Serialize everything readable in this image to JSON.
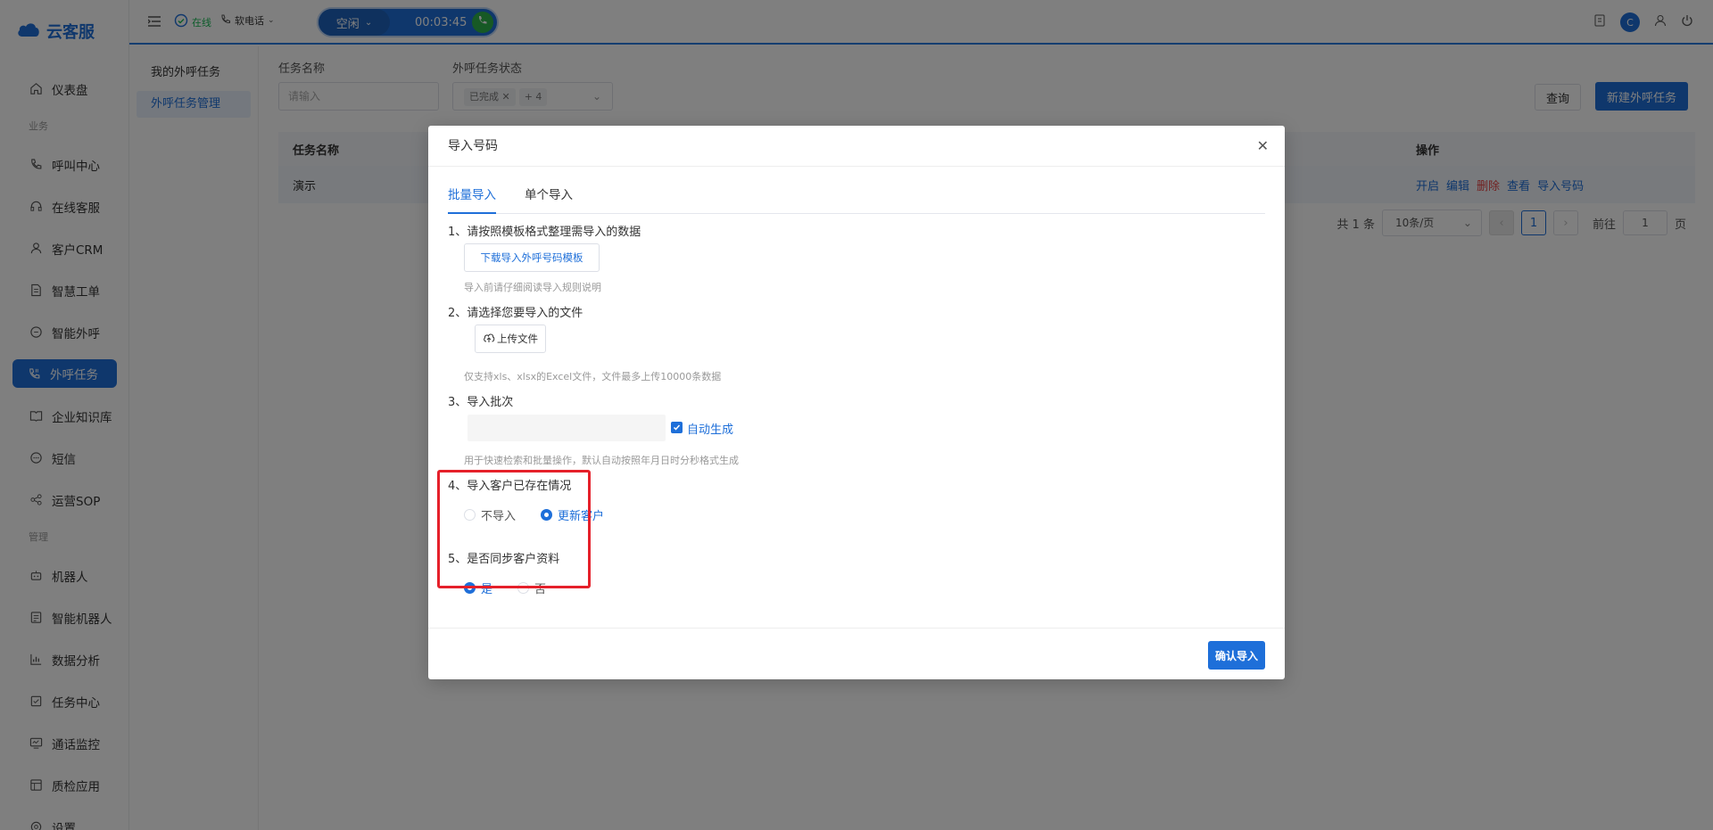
{
  "app": {
    "logo_text": "云客服"
  },
  "sidebar": {
    "items": [
      {
        "type": "item",
        "label": "仪表盘",
        "icon": "home-icon"
      },
      {
        "type": "group",
        "label": "业务"
      },
      {
        "type": "item",
        "label": "呼叫中心",
        "icon": "phone-icon"
      },
      {
        "type": "item",
        "label": "在线客服",
        "icon": "headset-icon"
      },
      {
        "type": "item",
        "label": "客户CRM",
        "icon": "user-icon"
      },
      {
        "type": "item",
        "label": "智慧工单",
        "icon": "document-icon"
      },
      {
        "type": "item",
        "label": "智能外呼",
        "icon": "outbound-call-icon"
      },
      {
        "type": "item",
        "label": "外呼任务",
        "icon": "phone-task-icon",
        "active": true
      },
      {
        "type": "item",
        "label": "企业知识库",
        "icon": "book-icon"
      },
      {
        "type": "item",
        "label": "短信",
        "icon": "message-icon"
      },
      {
        "type": "item",
        "label": "运营SOP",
        "icon": "share-icon"
      },
      {
        "type": "group",
        "label": "管理"
      },
      {
        "type": "item",
        "label": "机器人",
        "icon": "robot-icon"
      },
      {
        "type": "item",
        "label": "智能机器人",
        "icon": "smart-robot-icon"
      },
      {
        "type": "item",
        "label": "数据分析",
        "icon": "chart-icon"
      },
      {
        "type": "item",
        "label": "任务中心",
        "icon": "task-icon"
      },
      {
        "type": "item",
        "label": "通话监控",
        "icon": "monitor-icon"
      },
      {
        "type": "item",
        "label": "质检应用",
        "icon": "quality-icon"
      },
      {
        "type": "item",
        "label": "设置",
        "icon": "settings-icon"
      }
    ]
  },
  "topbar": {
    "online_label": "在线",
    "soft_phone_label": "软电话",
    "call_state": "空闲",
    "call_timer": "00:03:45",
    "avatar_letter": "C"
  },
  "subnav": {
    "items": [
      {
        "label": "我的外呼任务",
        "active": false
      },
      {
        "label": "外呼任务管理",
        "active": true
      }
    ]
  },
  "filters": {
    "task_name_label": "任务名称",
    "task_name_placeholder": "请输入",
    "status_label": "外呼任务状态",
    "status_tag": "已完成",
    "status_more": "+ 4",
    "query_button": "查询",
    "new_task_button": "新建外呼任务"
  },
  "table": {
    "headers": {
      "name": "任务名称",
      "ops": "操作"
    },
    "rows": [
      {
        "name": "演示",
        "ops": [
          "开启",
          "编辑",
          "删除",
          "查看",
          "导入号码"
        ]
      }
    ]
  },
  "pagination": {
    "total": "共 1 条",
    "page_size": "10条/页",
    "current_page": "1",
    "goto_label": "前往",
    "goto_value": "1",
    "page_suffix": "页"
  },
  "modal": {
    "title": "导入号码",
    "tabs": [
      "批量导入",
      "单个导入"
    ],
    "step1": "1、请按照模板格式整理需导入的数据",
    "download_button": "下载导入外呼号码模板",
    "step1_hint": "导入前请仔细阅读导入规则说明",
    "step2": "2、请选择您要导入的文件",
    "upload_button": "上传文件",
    "step2_hint": "仅支持xls、xlsx的Excel文件，文件最多上传10000条数据",
    "step3": "3、导入批次",
    "auto_generate": "自动生成",
    "step3_hint": "用于快速检索和批量操作，默认自动按照年月日时分秒格式生成",
    "step4": "4、导入客户已存在情况",
    "step4_options": [
      "不导入",
      "更新客户"
    ],
    "step4_selected": 1,
    "step5": "5、是否同步客户资料",
    "step5_options": [
      "是",
      "否"
    ],
    "step5_selected": 0,
    "confirm_button": "确认导入"
  }
}
